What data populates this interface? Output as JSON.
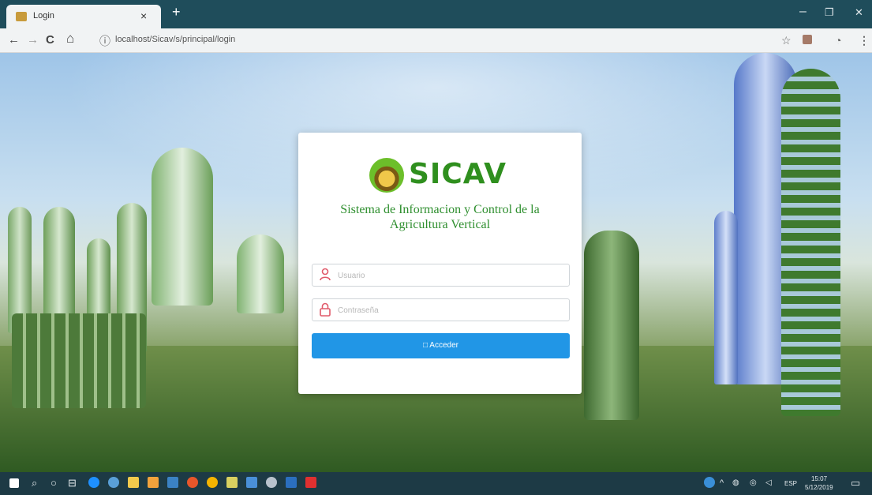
{
  "browser": {
    "tab_title": "Login",
    "tab_close": "×",
    "new_tab": "+",
    "win_minimize": "–",
    "win_restore": "❐",
    "win_close": "✕",
    "nav_back": "←",
    "nav_forward": "→",
    "nav_reload": "C",
    "nav_home": "⌂",
    "address_info": "ⓘ",
    "url": "localhost/Sicav/s/principal/login"
  },
  "login": {
    "brand": "SICAV",
    "subtitle": "Sistema de Informacion y Control de la Agricultura Vertical",
    "username_placeholder": "Usuario",
    "password_placeholder": "Contraseña",
    "submit_label": "Acceder"
  },
  "taskbar": {
    "language": "ESP",
    "time": "15:07",
    "date": "5/12/2019"
  },
  "colors": {
    "brand_green": "#2f8f1e",
    "button_blue": "#2196e6",
    "icon_red": "#e05a6a"
  }
}
